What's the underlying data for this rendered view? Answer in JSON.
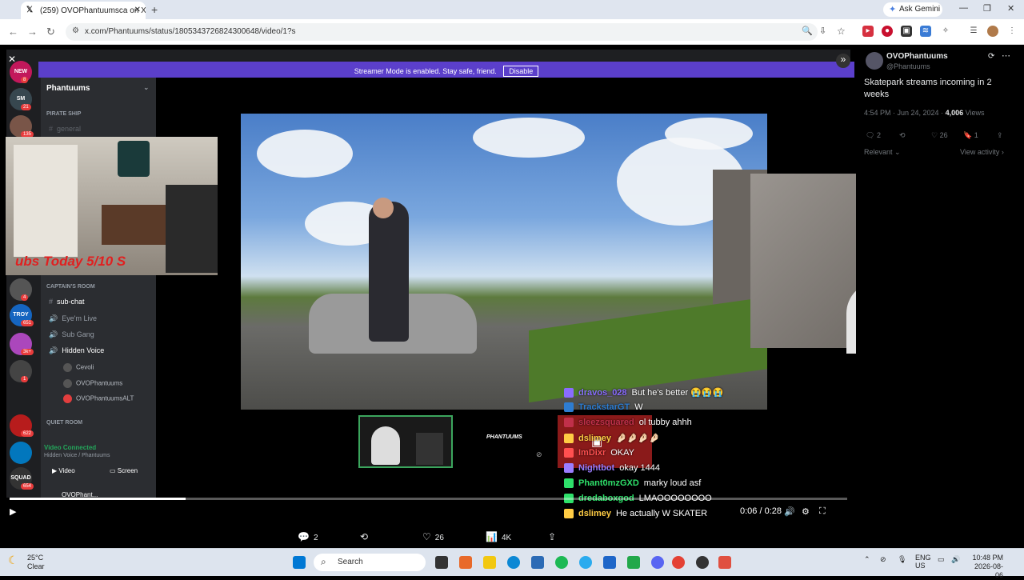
{
  "browser": {
    "tab_title": "(259) OVOPhantuumsca on X: \"S",
    "tab_close": "✕",
    "new_tab": "+",
    "ask_gemini": "Ask Gemini",
    "url": "x.com/Phantuums/status/1805343726824300648/video/1?s"
  },
  "discord": {
    "streamer_mode_text": "Streamer Mode is enabled. Stay safe, friend.",
    "disable_label": "Disable",
    "server_name": "Phantuums",
    "cat_pirate": "PIRATE SHIP",
    "ch_general": "general",
    "cat_captain": "CAPTAIN'S ROOM",
    "ch_subchat": "sub-chat",
    "ch_eyemlive": "Eye'm Live",
    "ch_subgang": "Sub Gang",
    "ch_hidden": "Hidden Voice",
    "voice_users": [
      "Cevoli",
      "OVOPhantuums",
      "OVOPhantuumsALT"
    ],
    "cat_quiet": "QUIET ROOM",
    "video_connected": "Video Connected",
    "connected_sub": "Hidden Voice / Phantuums",
    "btn_video": "Video",
    "btn_screen": "Screen",
    "self_user": "OVOPhant...",
    "overlay_text": "ubs Today 5/10 S",
    "guild_badges": [
      "8",
      "21",
      "135",
      "4",
      "651",
      "3k+",
      "1",
      "622",
      "654"
    ],
    "guild_labels": [
      "NEW",
      "SM",
      "TROY",
      "SQUAD"
    ]
  },
  "chat": [
    {
      "user": "dravos_028",
      "msg": "But he's better 😭😭😭",
      "color": "#8a6cff"
    },
    {
      "user": "TrackstarGT",
      "msg": "W",
      "color": "#2e7dd1"
    },
    {
      "user": "sleezsquared",
      "msg": "ol tubby ahhh",
      "color": "#c0304a"
    },
    {
      "user": "dslimey",
      "msg": "🤌🏻🤌🏻🤌🏻🤌🏻",
      "color": "#ffcc44"
    },
    {
      "user": "ImDixr",
      "msg": "OKAY",
      "color": "#ff5050"
    },
    {
      "user": "Nightbot",
      "msg": "okay 1444",
      "color": "#9b7dff"
    },
    {
      "user": "Phant0mzGXD",
      "msg": "marky loud asf",
      "color": "#2ee06a"
    },
    {
      "user": "dredaboxgod",
      "msg": "LMAOOOOOOOO",
      "color": "#2ee06a"
    },
    {
      "user": "dslimey",
      "msg": "He actually W SKATER",
      "color": "#ffcc44"
    }
  ],
  "player": {
    "time": "0:06 / 0:28",
    "progress_fraction": 0.21
  },
  "actions": {
    "replies": "2",
    "likes": "26",
    "views": "4K"
  },
  "tweet": {
    "name": "OVOPhantuums",
    "handle": "@Phantuums",
    "text": "Skatepark streams incoming in 2 weeks",
    "time": "4:54 PM · Jun 24, 2024 ·",
    "views_count": "4,006",
    "views_label": "Views",
    "replies": "2",
    "likes": "26",
    "bookmarks": "1",
    "sort": "Relevant",
    "view_activity": "View activity"
  },
  "taskbar": {
    "temp": "25°C",
    "condition": "Clear",
    "search": "Search",
    "lang1": "ENG",
    "lang2": "US",
    "time": "10:48 PM",
    "date": "2026-08-06"
  },
  "thumb_label": "PHANTUUMS"
}
